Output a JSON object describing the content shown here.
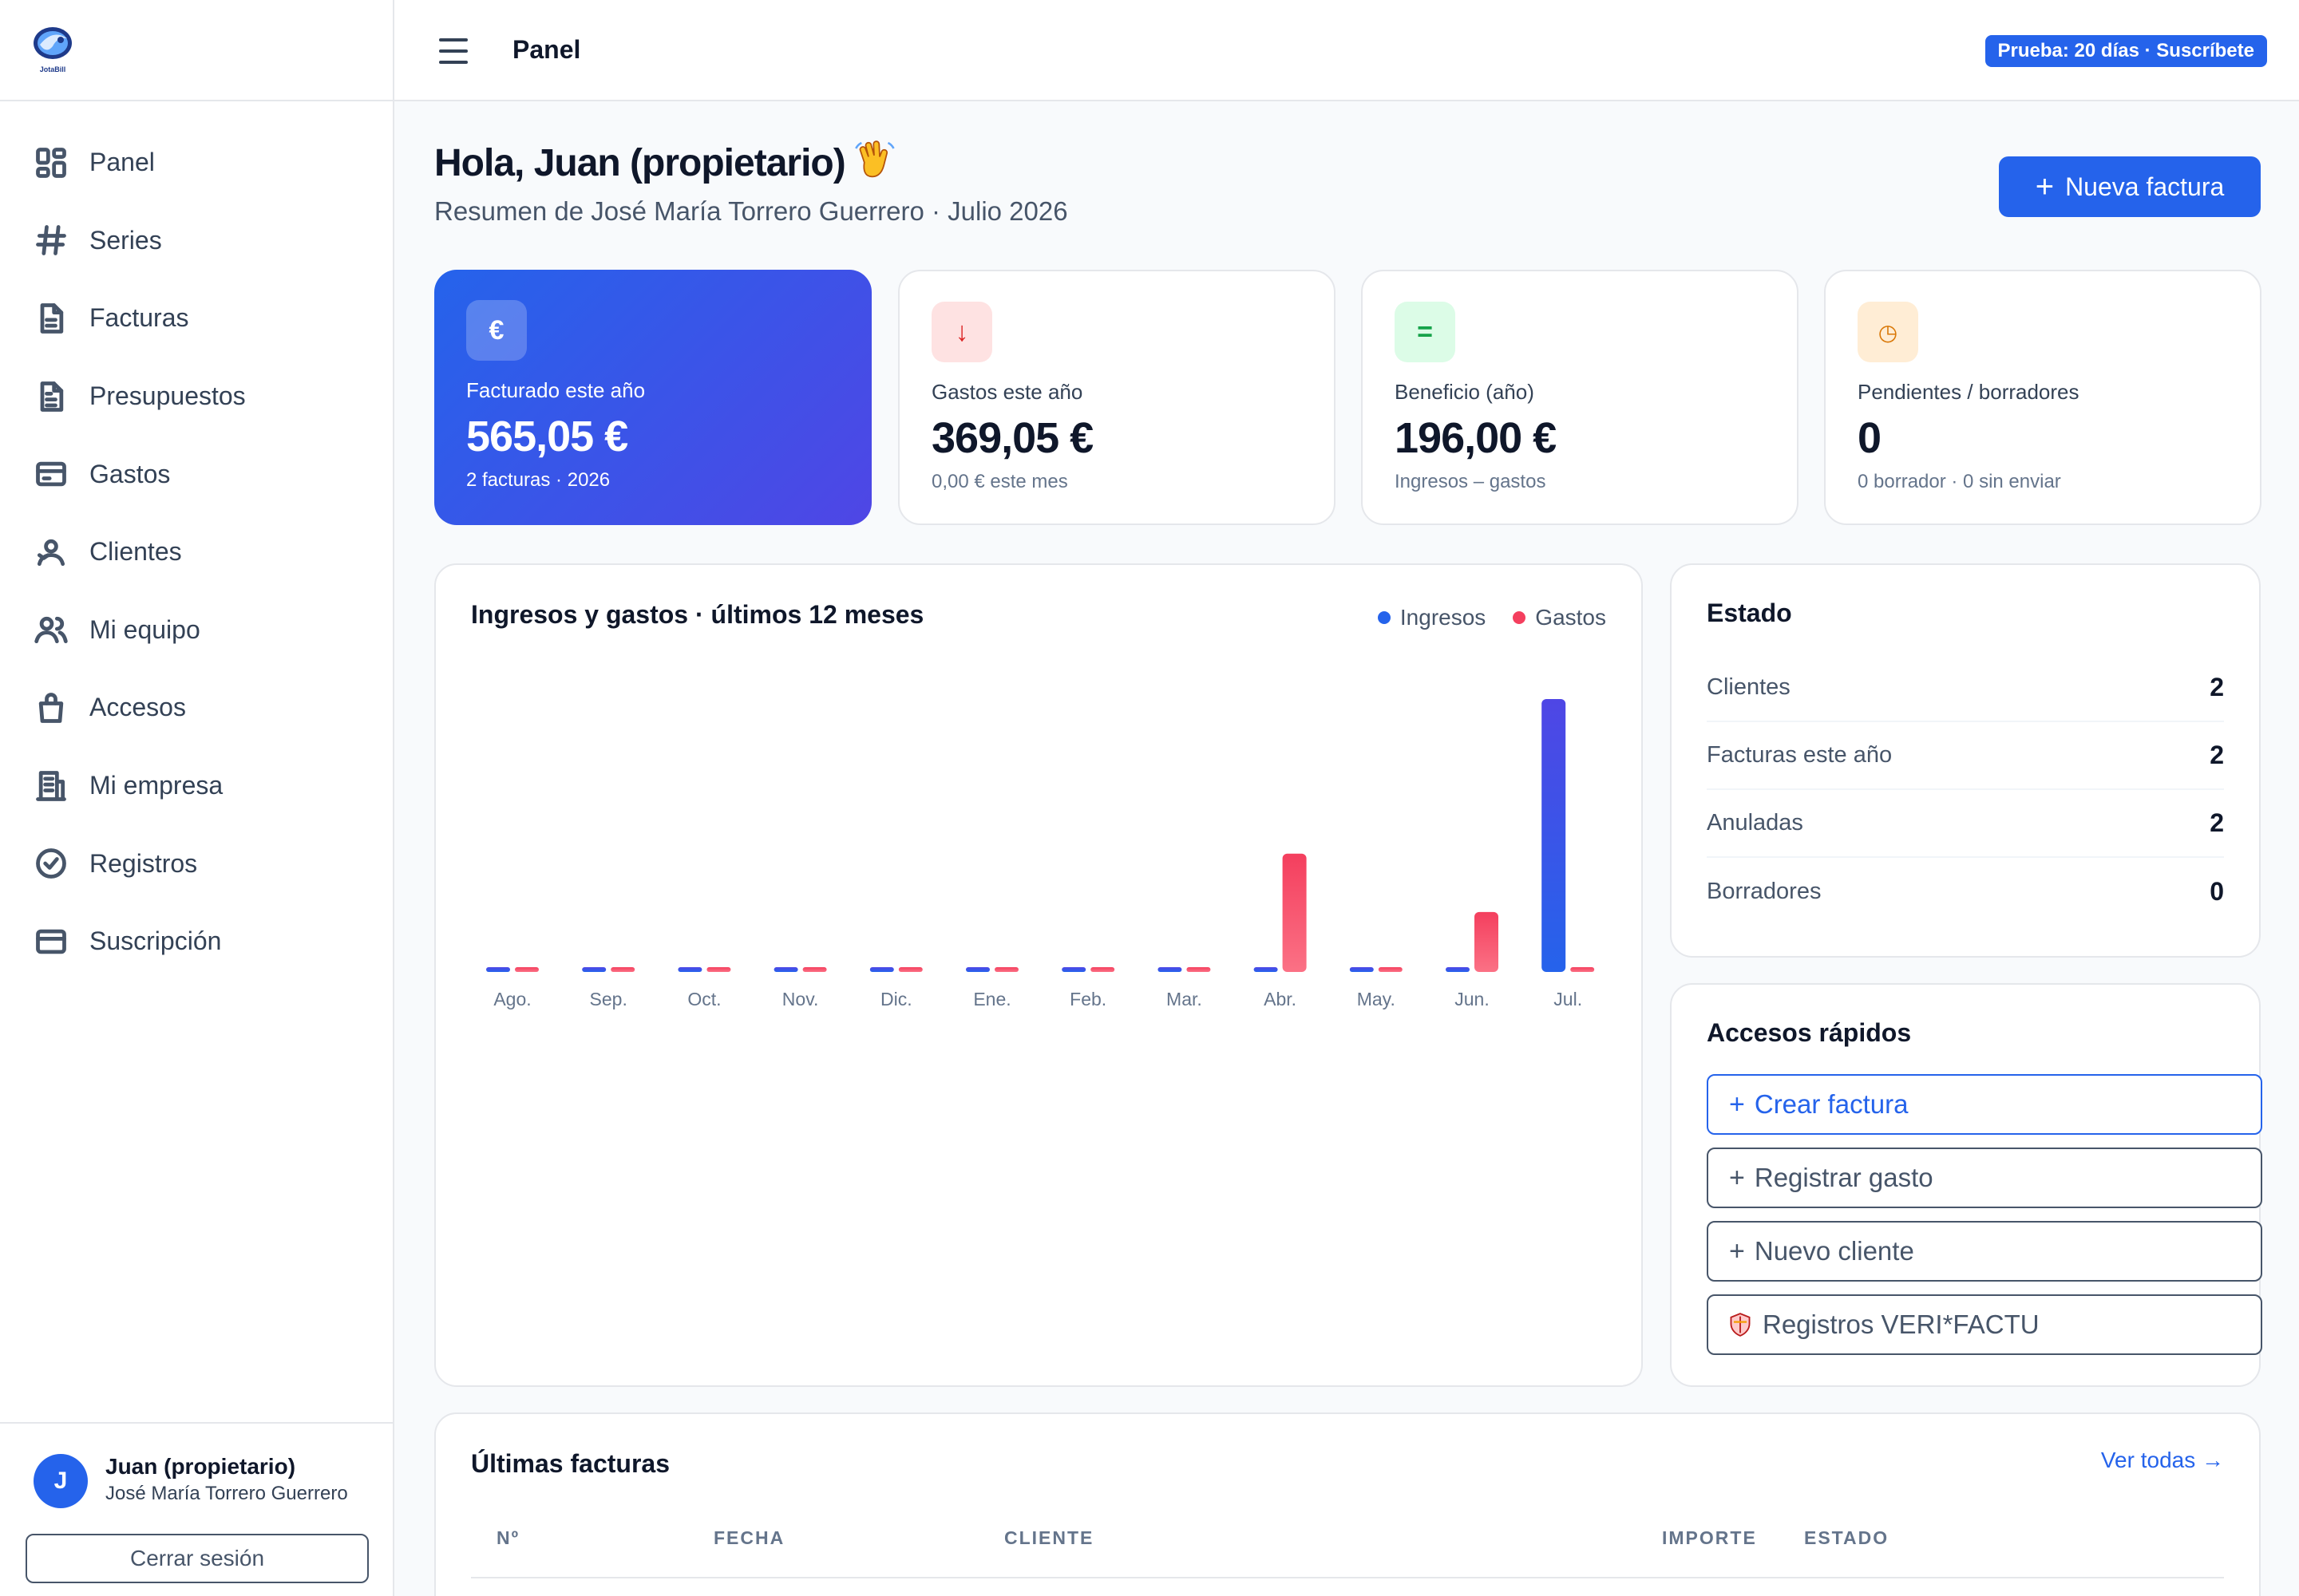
{
  "sidebar": {
    "logo_text": "JotaBill",
    "items": [
      {
        "label": "Panel",
        "icon": "grid-icon"
      },
      {
        "label": "Series",
        "icon": "hash-icon"
      },
      {
        "label": "Facturas",
        "icon": "document-icon"
      },
      {
        "label": "Presupuestos",
        "icon": "document-lines-icon"
      },
      {
        "label": "Gastos",
        "icon": "receipt-icon"
      },
      {
        "label": "Clientes",
        "icon": "client-icon"
      },
      {
        "label": "Mi equipo",
        "icon": "team-icon"
      },
      {
        "label": "Accesos",
        "icon": "bag-icon"
      },
      {
        "label": "Mi empresa",
        "icon": "building-icon"
      },
      {
        "label": "Registros",
        "icon": "check-circle-icon"
      },
      {
        "label": "Suscripción",
        "icon": "card-icon"
      }
    ],
    "user": {
      "initial": "J",
      "name": "Juan (propietario)",
      "company": "José María Torrero Guerrero"
    },
    "logout_label": "Cerrar sesión"
  },
  "topbar": {
    "title": "Panel",
    "trial_badge": "Prueba: 20 días · Suscríbete"
  },
  "header": {
    "greeting": "Hola, Juan (propietario)",
    "subtitle": "Resumen de José María Torrero Guerrero · Julio 2026",
    "new_invoice_label": "Nueva factura"
  },
  "stats": [
    {
      "icon_glyph": "€",
      "icon": "euro-icon",
      "label": "Facturado este año",
      "value": "565,05 €",
      "sub": "2 facturas · 2026"
    },
    {
      "icon_glyph": "↓",
      "icon": "arrow-down-icon",
      "label": "Gastos este año",
      "value": "369,05 €",
      "sub": "0,00 € este mes"
    },
    {
      "icon_glyph": "=",
      "icon": "equals-icon",
      "label": "Beneficio (año)",
      "value": "196,00 €",
      "sub": "Ingresos – gastos"
    },
    {
      "icon_glyph": "◷",
      "icon": "clock-icon",
      "label": "Pendientes / borradores",
      "value": "0",
      "sub": "0 borrador · 0 sin enviar"
    }
  ],
  "colors": {
    "accent": "#2563eb",
    "ingresos": "#3b5bdb",
    "gastos": "#f43f5e"
  },
  "chart_data": {
    "type": "bar",
    "title": "Ingresos y gastos · últimos 12 meses",
    "categories": [
      "Ago.",
      "Sep.",
      "Oct.",
      "Nov.",
      "Dic.",
      "Ene.",
      "Feb.",
      "Mar.",
      "Abr.",
      "May.",
      "Jun.",
      "Jul."
    ],
    "series": [
      {
        "name": "Ingresos",
        "values": [
          0,
          0,
          0,
          0,
          0,
          0,
          0,
          0,
          0,
          0,
          0,
          565.05
        ]
      },
      {
        "name": "Gastos",
        "values": [
          0,
          0,
          0,
          0,
          0,
          0,
          0,
          0,
          245,
          0,
          124.05,
          0
        ]
      }
    ],
    "legend": "top-right",
    "grid": false
  },
  "estado": {
    "title": "Estado",
    "rows": [
      {
        "label": "Clientes",
        "value": "2"
      },
      {
        "label": "Facturas este año",
        "value": "2"
      },
      {
        "label": "Anuladas",
        "value": "2"
      },
      {
        "label": "Borradores",
        "value": "0"
      }
    ]
  },
  "quick_access": {
    "title": "Accesos rápidos",
    "buttons": [
      {
        "icon": "+",
        "label": "Crear factura"
      },
      {
        "icon": "+",
        "label": "Registrar gasto"
      },
      {
        "icon": "+",
        "label": "Nuevo cliente"
      },
      {
        "icon": "shield-icon",
        "label": "Registros VERI*FACTU"
      }
    ]
  },
  "invoices": {
    "title": "Últimas facturas",
    "see_all": "Ver todas →",
    "columns": [
      "Nº",
      "FECHA",
      "CLIENTE",
      "IMPORTE",
      "ESTADO"
    ]
  }
}
